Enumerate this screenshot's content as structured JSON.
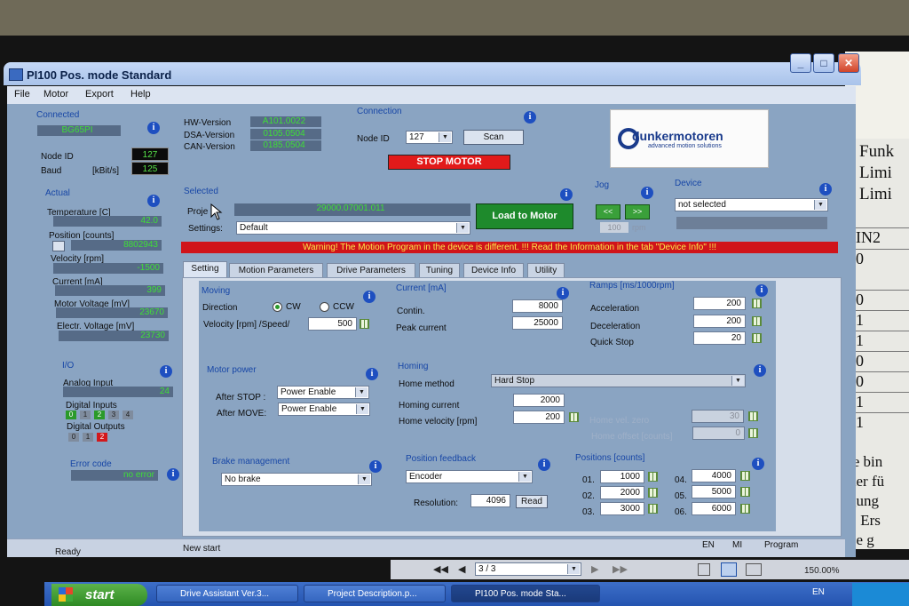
{
  "window": {
    "title": "PI100 Pos. mode Standard"
  },
  "menu": [
    "File",
    "Motor",
    "Export",
    "Help"
  ],
  "connected": {
    "header": "Connected",
    "device": "BG65PI",
    "node_id_label": "Node ID",
    "node_id": "127",
    "baud_label": "Baud",
    "baud_unit": "[kBit/s]",
    "baud": "125"
  },
  "versions": {
    "hw_label": "HW-Version",
    "hw": "A101.0022",
    "dsa_label": "DSA-Version",
    "dsa": "0105.0504",
    "can_label": "CAN-Version",
    "can": "0185.0504"
  },
  "connection": {
    "header": "Connection",
    "node_label": "Node ID",
    "node_value": "127",
    "scan": "Scan",
    "stop": "STOP MOTOR"
  },
  "logo": {
    "brand": "dunkermotoren",
    "tagline": "advanced motion solutions"
  },
  "actual": {
    "header": "Actual",
    "items": [
      {
        "label": "Temperature [C]",
        "value": "42.0"
      },
      {
        "label": "Position [counts]",
        "value": "8802943"
      },
      {
        "label": "Velocity [rpm]",
        "value": "-1500"
      },
      {
        "label": "Current [mA]",
        "value": "399"
      },
      {
        "label": "Motor Voltage [mV]",
        "value": "23670"
      },
      {
        "label": "Electr. Voltage [mV]",
        "value": "23730"
      }
    ]
  },
  "io": {
    "header": "I/O",
    "analog_label": "Analog Input",
    "analog": "24",
    "din_label": "Digital Inputs",
    "din": [
      "0",
      "1",
      "2",
      "3",
      "4"
    ],
    "dout_label": "Digital Outputs",
    "dout": [
      "0",
      "1",
      "2"
    ]
  },
  "error": {
    "label": "Error code",
    "value": "no error"
  },
  "selected": {
    "header": "Selected",
    "project_label": "Proje",
    "project": "29000.07001.011",
    "settings_label": "Settings:",
    "settings": "Default",
    "load": "Load to Motor"
  },
  "jog": {
    "header": "Jog",
    "left": "<<",
    "right": ">>",
    "value": "100",
    "unit": "rpm"
  },
  "device": {
    "header": "Device",
    "value": "not selected"
  },
  "warning": "Warning! The Motion Program in the device is different. !!! Read the Information in the tab \"Device Info\" !!!",
  "tabs": [
    "Setting",
    "Motion Parameters",
    "Drive Parameters",
    "Tuning",
    "Device Info",
    "Utility"
  ],
  "moving": {
    "header": "Moving",
    "direction_label": "Direction",
    "cw": "CW",
    "ccw": "CCW",
    "velocity_label": "Velocity [rpm] /Speed/",
    "velocity": "500"
  },
  "current": {
    "header": "Current [mA]",
    "contin_label": "Contin.",
    "contin": "8000",
    "peak_label": "Peak current",
    "peak": "25000"
  },
  "ramps": {
    "header": "Ramps [ms/1000rpm]",
    "acc_label": "Acceleration",
    "acc": "200",
    "dec_label": "Deceleration",
    "dec": "200",
    "qs_label": "Quick Stop",
    "qs": "20"
  },
  "motor_power": {
    "header": "Motor power",
    "after_stop_label": "After STOP :",
    "after_stop": "Power Enable",
    "after_move_label": "After MOVE:",
    "after_move": "Power Enable"
  },
  "homing": {
    "header": "Homing",
    "method_label": "Home method",
    "method": "Hard Stop",
    "current_label": "Homing current",
    "current": "2000",
    "velocity_label": "Home velocity [rpm]",
    "velocity": "200",
    "zero_label": "Home vel. zero",
    "zero": "30",
    "offset_label": "Home offset [counts]",
    "offset": "0"
  },
  "brake": {
    "header": "Brake management",
    "value": "No brake"
  },
  "feedback": {
    "header": "Position feedback",
    "value": "Encoder",
    "res_label": "Resolution:",
    "res": "4096",
    "read": "Read"
  },
  "positions": {
    "header": "Positions [counts]",
    "items": [
      {
        "label": "01.",
        "value": "1000"
      },
      {
        "label": "02.",
        "value": "2000"
      },
      {
        "label": "03.",
        "value": "3000"
      },
      {
        "label": "04.",
        "value": "4000"
      },
      {
        "label": "05.",
        "value": "5000"
      },
      {
        "label": "06.",
        "value": "6000"
      }
    ]
  },
  "status": {
    "ready": "Ready",
    "new_start": "New start",
    "lang": "EN",
    "mi": "MI",
    "program": "Program"
  },
  "viewer": {
    "page": "3 / 3",
    "zoom": "150.00%"
  },
  "taskbar": {
    "start": "start",
    "tasks": [
      "Drive Assistant Ver.3...",
      "Project Description.p...",
      "PI100 Pos. mode Sta..."
    ],
    "lang": "EN"
  },
  "doc": {
    "words": [
      "Funk",
      "Limi",
      "Limi"
    ],
    "cells": [
      "IN2",
      "0",
      "0",
      "1",
      "1",
      "0",
      "0",
      "1",
      "1"
    ],
    "text": [
      "ie bin",
      "der fü",
      "gung",
      "t. Ers",
      "be g"
    ]
  }
}
